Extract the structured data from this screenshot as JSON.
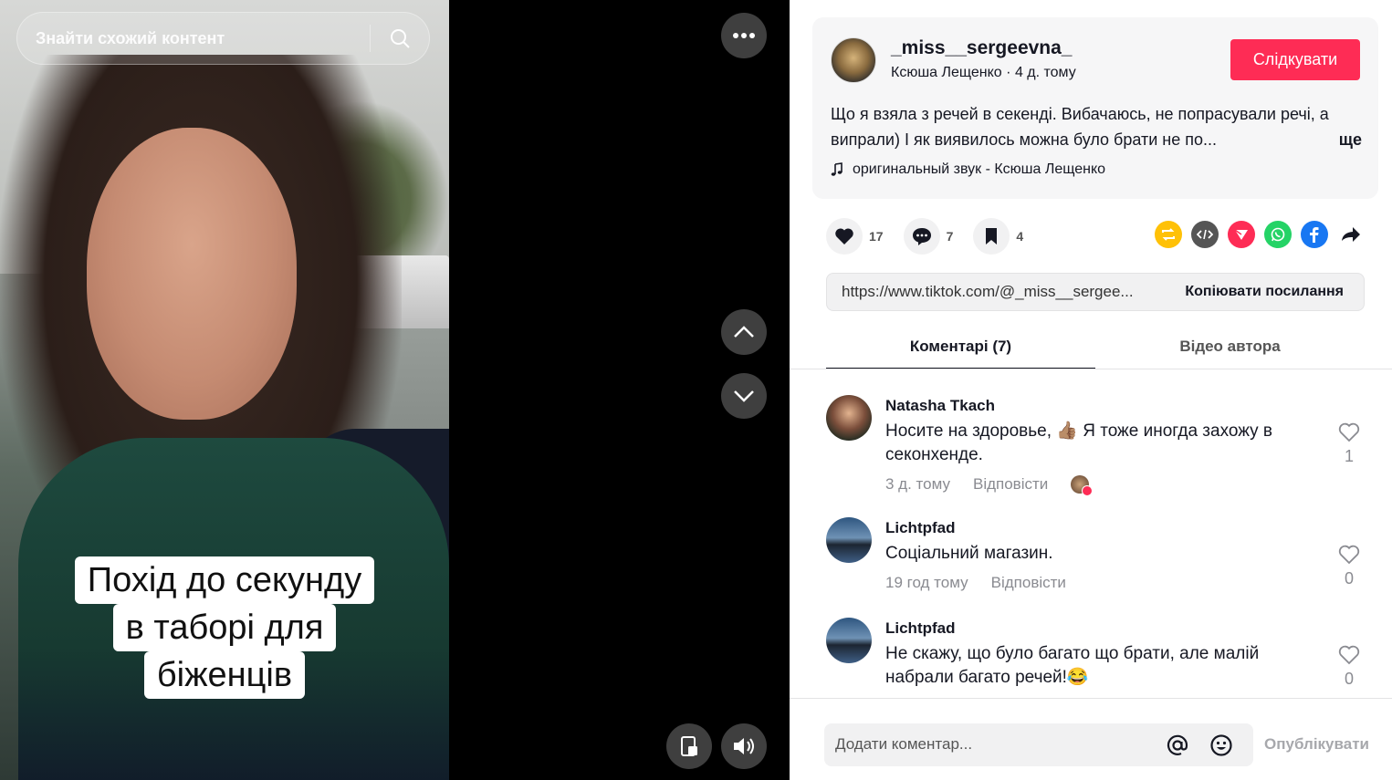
{
  "search": {
    "placeholder": "Знайти схожий контент"
  },
  "caption": {
    "lines": [
      "Похід до секунду",
      "в таборі для",
      "біженців"
    ]
  },
  "author": {
    "handle": "_miss__sergeevna_",
    "name": "Ксюша Лещенко",
    "time": "4 д. тому",
    "follow_label": "Слідкувати"
  },
  "post": {
    "description": "Що я взяла з речей в секенді. Вибачаюсь, не попрасували речі, а випрали) І як виявилось можна було брати не по...",
    "more_label": "ще",
    "sound": "оригинальный звук - Ксюша Лещенко"
  },
  "stats": {
    "likes": "17",
    "comments": "7",
    "saves": "4"
  },
  "share": {
    "url": "https://www.tiktok.com/@_miss__sergee...",
    "copy_label": "Копіювати посилання",
    "colors": {
      "repost": "#ffc107",
      "embed": "#555555",
      "send": "#fe2c55",
      "whatsapp": "#25d366",
      "facebook": "#1877f2"
    }
  },
  "tabs": [
    {
      "label": "Коментарі (7)",
      "active": true
    },
    {
      "label": "Відео автора",
      "active": false
    }
  ],
  "comments": [
    {
      "name": "Natasha Tkach",
      "text": "Носите на здоровье, 👍🏽 Я тоже иногда захожу в секонхенде.",
      "time": "3 д. тому",
      "reply": "Відповісти",
      "likes": "1"
    },
    {
      "name": "Lichtpfad",
      "text": "Соціальний магазин.",
      "time": "19 год тому",
      "reply": "Відповісти",
      "likes": "0"
    },
    {
      "name": "Lichtpfad",
      "text": "Не скажу, що було багато що брати, але малій набрали багато речей!😂",
      "time": "",
      "reply": "",
      "likes": "0"
    }
  ],
  "composer": {
    "placeholder": "Додати коментар...",
    "publish_label": "Опублікувати"
  },
  "theme": {
    "accent": "#fe2c55"
  }
}
